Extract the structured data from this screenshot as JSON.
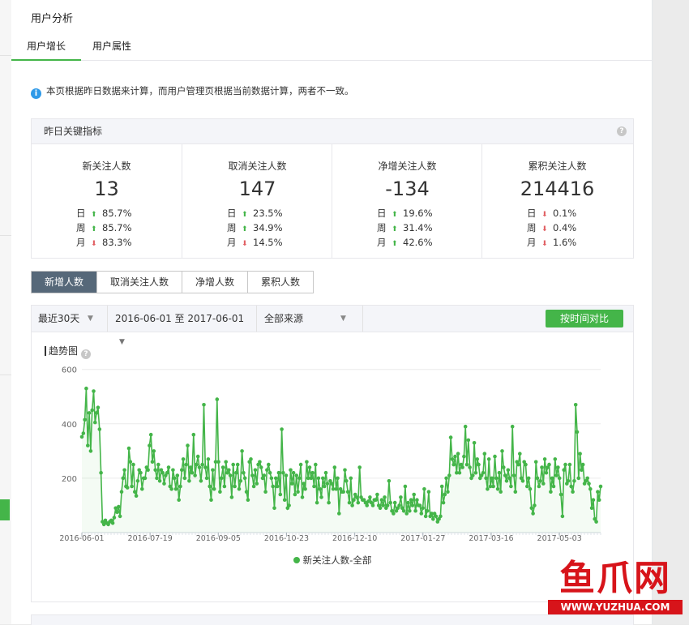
{
  "page": {
    "title": "用户分析",
    "tabs": [
      {
        "label": "用户增长",
        "active": true
      },
      {
        "label": "用户属性",
        "active": false
      }
    ],
    "notice": "本页根据昨日数据来计算，而用户管理页根据当前数据计算，两者不一致。"
  },
  "kpi": {
    "title": "昨日关键指标",
    "help": "?",
    "period_labels": [
      "日",
      "周",
      "月"
    ],
    "items": [
      {
        "label": "新关注人数",
        "value": "13",
        "rows": [
          {
            "dir": "up",
            "pct": "85.7%"
          },
          {
            "dir": "up",
            "pct": "85.7%"
          },
          {
            "dir": "down",
            "pct": "83.3%"
          }
        ]
      },
      {
        "label": "取消关注人数",
        "value": "147",
        "rows": [
          {
            "dir": "up",
            "pct": "23.5%"
          },
          {
            "dir": "up",
            "pct": "34.9%"
          },
          {
            "dir": "down",
            "pct": "14.5%"
          }
        ]
      },
      {
        "label": "净增关注人数",
        "value": "-134",
        "rows": [
          {
            "dir": "up",
            "pct": "19.6%"
          },
          {
            "dir": "up",
            "pct": "31.4%"
          },
          {
            "dir": "up",
            "pct": "42.6%"
          }
        ]
      },
      {
        "label": "累积关注人数",
        "value": "214416",
        "rows": [
          {
            "dir": "down",
            "pct": "0.1%"
          },
          {
            "dir": "down",
            "pct": "0.4%"
          },
          {
            "dir": "down",
            "pct": "1.6%"
          }
        ]
      }
    ]
  },
  "segments": [
    {
      "label": "新增人数",
      "active": true
    },
    {
      "label": "取消关注人数",
      "active": false
    },
    {
      "label": "净增人数",
      "active": false
    },
    {
      "label": "累积人数",
      "active": false
    }
  ],
  "filters": {
    "range": "最近30天",
    "dates": "2016-06-01 至 2017-06-01",
    "source": "全部来源",
    "compare_button": "按时间对比"
  },
  "trend_title": "趋势图",
  "colors": {
    "accent": "#44b549",
    "up": "#44b549",
    "down": "#e15f63",
    "segment_active": "#566879",
    "info": "#2f9ae8"
  },
  "watermark": {
    "chars": "鱼爪网",
    "url": "WWW.YUZHUA.COM"
  },
  "chart_data": {
    "type": "line",
    "x_start": "2016-06-01",
    "x_end": "2017-06-01",
    "x_ticks": [
      "2016-06-01",
      "2016-07-19",
      "2016-09-05",
      "2016-10-23",
      "2016-12-10",
      "2017-01-27",
      "2017-03-16",
      "2017-05-03"
    ],
    "y_ticks": [
      200,
      400,
      600
    ],
    "ylim": [
      0,
      620
    ],
    "grid": true,
    "legend_position": "bottom",
    "series": [
      {
        "name": "新关注人数-全部",
        "values": [
          352,
          365,
          415,
          530,
          320,
          440,
          300,
          450,
          520,
          405,
          440,
          460,
          380,
          220,
          40,
          30,
          45,
          35,
          30,
          40,
          45,
          35,
          55,
          90,
          75,
          95,
          60,
          150,
          200,
          230,
          170,
          165,
          310,
          260,
          170,
          250,
          150,
          135,
          190,
          230,
          220,
          160,
          200,
          200,
          240,
          230,
          320,
          360,
          260,
          300,
          230,
          200,
          250,
          190,
          230,
          220,
          180,
          210,
          220,
          240,
          170,
          160,
          230,
          200,
          160,
          210,
          120,
          170,
          230,
          270,
          200,
          250,
          320,
          190,
          240,
          220,
          360,
          210,
          250,
          280,
          240,
          190,
          250,
          470,
          240,
          200,
          270,
          170,
          120,
          230,
          160,
          260,
          490,
          260,
          150,
          200,
          240,
          170,
          260,
          220,
          230,
          210,
          130,
          250,
          170,
          220,
          250,
          160,
          190,
          300,
          220,
          200,
          150,
          120,
          260,
          270,
          210,
          170,
          230,
          180,
          250,
          260,
          240,
          200,
          210,
          150,
          230,
          250,
          220,
          200,
          170,
          90,
          200,
          170,
          220,
          140,
          380,
          220,
          120,
          210,
          90,
          100,
          230,
          180,
          220,
          140,
          210,
          150,
          200,
          250,
          130,
          180,
          160,
          260,
          200,
          240,
          200,
          220,
          170,
          250,
          110,
          200,
          160,
          130,
          200,
          170,
          220,
          180,
          110,
          190,
          180,
          160,
          240,
          160,
          200,
          70,
          160,
          150,
          150,
          230,
          190,
          150,
          110,
          200,
          100,
          120,
          140,
          130,
          110,
          240,
          130,
          120,
          120,
          110,
          100,
          115,
          130,
          110,
          100,
          120,
          120,
          140,
          100,
          90,
          120,
          100,
          130,
          90,
          100,
          190,
          110,
          80,
          70,
          110,
          80,
          90,
          100,
          130,
          90,
          80,
          170,
          70,
          110,
          80,
          120,
          100,
          140,
          80,
          120,
          100,
          100,
          70,
          90,
          160,
          60,
          80,
          150,
          60,
          70,
          50,
          70,
          60,
          40,
          50,
          60,
          170,
          110,
          140,
          200,
          150,
          210,
          350,
          270,
          250,
          280,
          220,
          290,
          220,
          250,
          240,
          280,
          390,
          250,
          340,
          240,
          200,
          210,
          330,
          220,
          270,
          250,
          200,
          210,
          220,
          290,
          200,
          160,
          270,
          170,
          200,
          170,
          280,
          200,
          160,
          220,
          150,
          300,
          240,
          210,
          190,
          230,
          200,
          170,
          390,
          210,
          150,
          260,
          250,
          290,
          200,
          190,
          260,
          250,
          170,
          200,
          160,
          90,
          70,
          100,
          260,
          200,
          170,
          190,
          240,
          180,
          270,
          220,
          240,
          250,
          150,
          200,
          170,
          270,
          210,
          240,
          200,
          140,
          60,
          230,
          250,
          180,
          190,
          250,
          170,
          150,
          190,
          470,
          370,
          200,
          290,
          230,
          250,
          180,
          190,
          200,
          180,
          160,
          90,
          120,
          50,
          40,
          150,
          120,
          170
        ]
      }
    ]
  }
}
